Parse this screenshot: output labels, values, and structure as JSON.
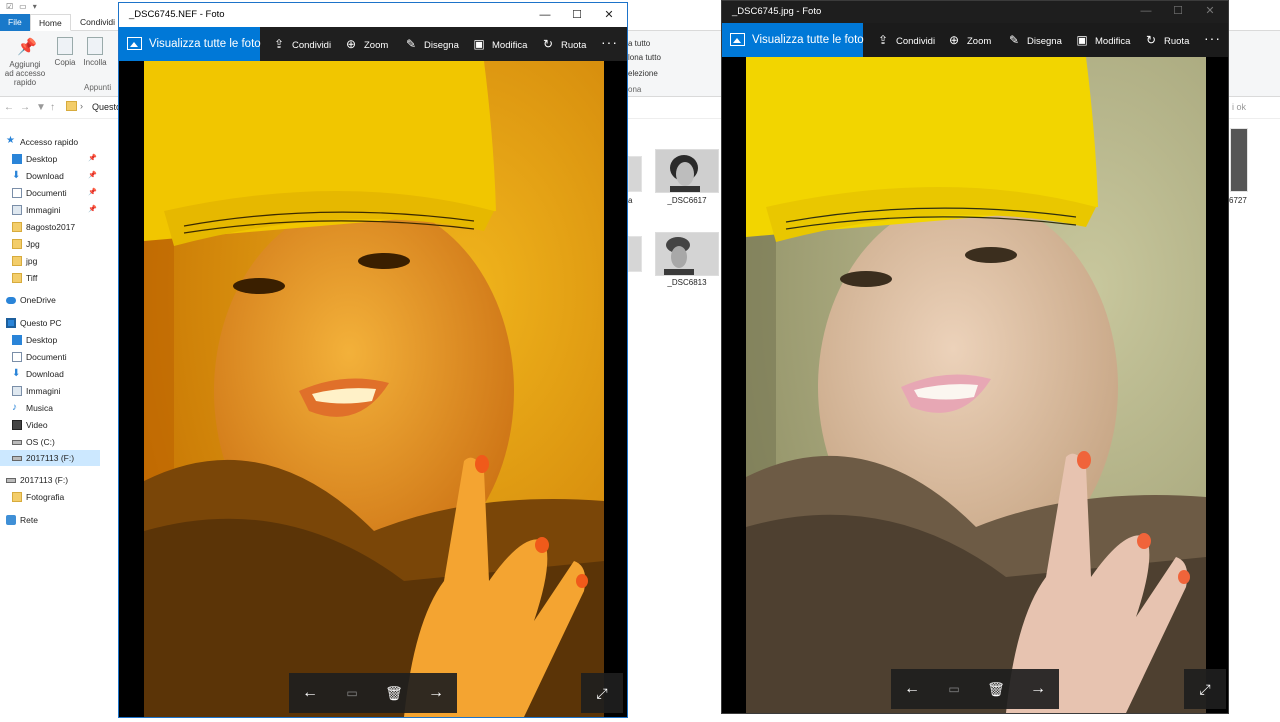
{
  "explorer": {
    "ribbon_tabs": {
      "file": "File",
      "home": "Home",
      "share": "Condividi"
    },
    "ribbon_buttons": {
      "pin": "Aggiungi ad accesso rapido",
      "copy": "Copia",
      "paste": "Incolla",
      "group_clipboard": "Appunti",
      "select_all": "a tutto",
      "deselect_all": "lona tutto",
      "invert_selection": "elezione",
      "group_select": "ona"
    },
    "address": {
      "path": "Questo",
      "search_hint": "i ok"
    },
    "nav_pane": {
      "quick_access": "Accesso rapido",
      "qa_items": [
        "Desktop",
        "Download",
        "Documenti",
        "Immagini",
        "8agosto2017",
        "Jpg",
        "jpg",
        "Tiff"
      ],
      "onedrive": "OneDrive",
      "this_pc": "Questo PC",
      "pc_items": [
        "Desktop",
        "Documenti",
        "Download",
        "Immagini",
        "Musica",
        "Video",
        "OS (C:)",
        "2017113 (F:)"
      ],
      "drive": "2017113 (F:)",
      "drive_items": [
        "Fotografia"
      ],
      "network": "Rete"
    },
    "files": [
      {
        "name": "_DSC6617"
      },
      {
        "name": "_DSC6813"
      }
    ],
    "partial_labels": {
      "left_a": "a",
      "right_a": "6727"
    }
  },
  "left_window": {
    "title": "_DSC6745.NEF - Foto",
    "view_all": "Visualizza tutte le foto",
    "toolbar": [
      "Condividi",
      "Zoom",
      "Disegna",
      "Modifica",
      "Ruota"
    ],
    "more": "···",
    "photo_tint": "#f0a500"
  },
  "right_window": {
    "title": "_DSC6745.jpg - Foto",
    "view_all": "Visualizza tutte le foto",
    "toolbar": [
      "Condividi",
      "Zoom",
      "Disegna",
      "Modifica",
      "Ruota"
    ],
    "more": "···",
    "photo_tint": "#b7b88a"
  },
  "icons": {
    "share": "share-icon",
    "zoom": "zoom-icon",
    "draw": "draw-icon",
    "edit": "edit-icon",
    "rotate": "rotate-icon",
    "back": "arrow-left-icon",
    "slideshow": "slideshow-icon",
    "delete": "trash-icon",
    "forward": "arrow-right-icon",
    "fullscreen": "fullscreen-icon"
  },
  "colors": {
    "accent": "#0078d7",
    "toolbar_bg": "#1f1f1f",
    "hat_yellow": "#f2cf00"
  }
}
